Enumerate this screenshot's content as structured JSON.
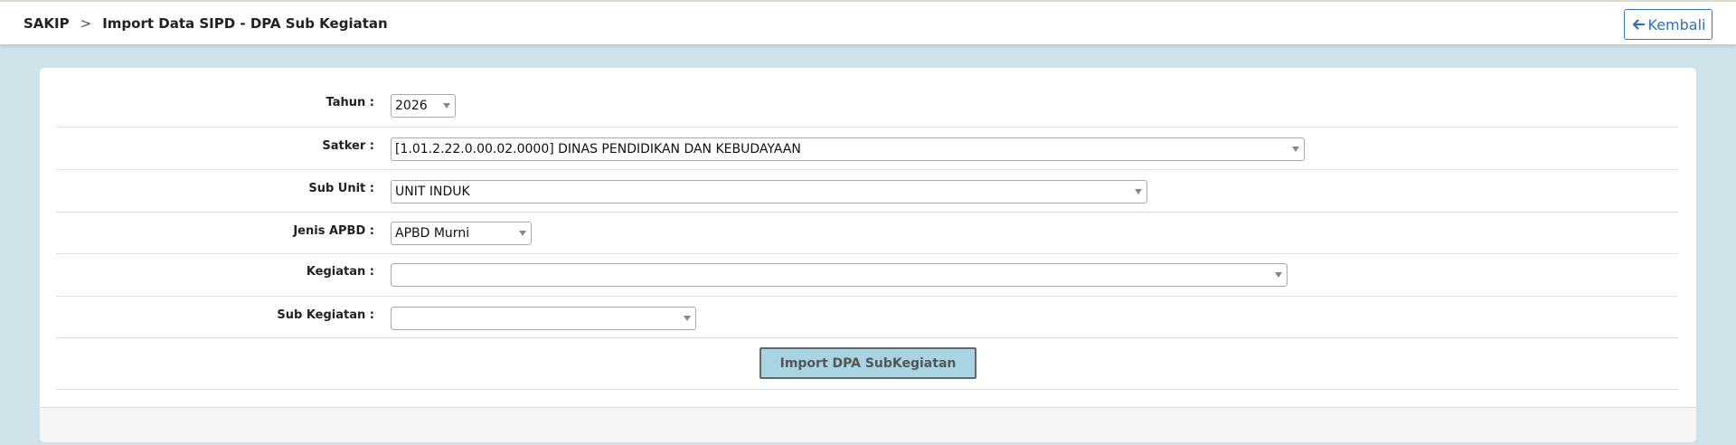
{
  "header": {
    "breadcrumb_root": "SAKIP",
    "breadcrumb_separator": ">",
    "page_title": "Import Data SIPD - DPA Sub Kegiatan",
    "back_button_label": "Kembali",
    "back_icon": "arrow-left-icon"
  },
  "form": {
    "tahun": {
      "label": "Tahun :",
      "value": "2026"
    },
    "satker": {
      "label": "Satker :",
      "value": "[1.01.2.22.0.00.02.0000] DINAS PENDIDIKAN DAN KEBUDAYAAN"
    },
    "sub_unit": {
      "label": "Sub Unit :",
      "value": "UNIT INDUK"
    },
    "jenis_apbd": {
      "label": "Jenis APBD :",
      "value": "APBD Murni"
    },
    "kegiatan": {
      "label": "Kegiatan :",
      "value": ""
    },
    "sub_kegiatan": {
      "label": "Sub Kegiatan :",
      "value": ""
    },
    "import_button_label": "Import DPA SubKegiatan"
  },
  "colors": {
    "page_background": "#cfe1e9",
    "accent_blue": "#2f6fc3",
    "import_button_bg": "#a9d4e1"
  }
}
